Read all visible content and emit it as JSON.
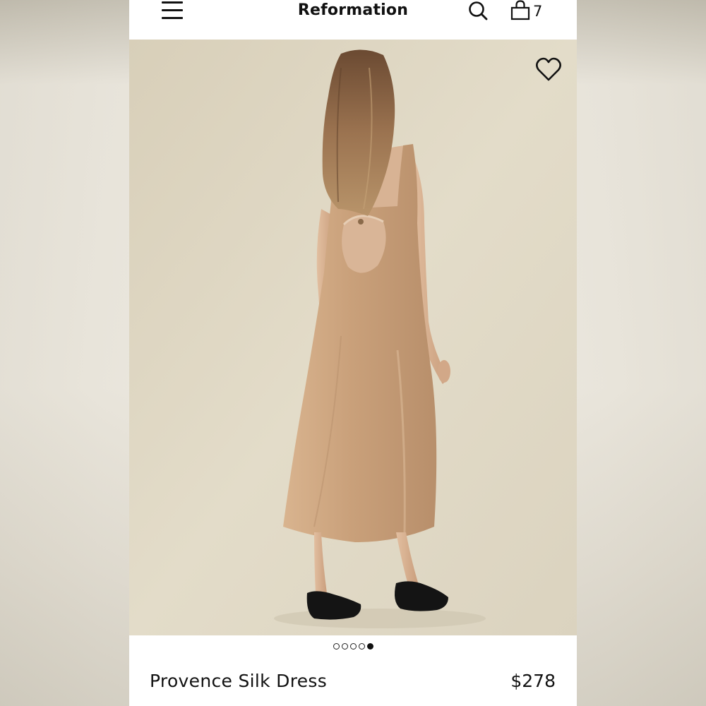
{
  "header": {
    "brand": "Reformation",
    "menu_icon": "hamburger-menu-icon",
    "search_icon": "search-icon",
    "bag_icon": "shopping-bag-icon",
    "bag_count": "7"
  },
  "gallery": {
    "favorite_icon": "heart-outline-icon",
    "image_count": 5,
    "active_index": 5
  },
  "product": {
    "name": "Provence Silk Dress",
    "price": "$278"
  },
  "colors": {
    "text": "#111111",
    "background": "#ffffff",
    "photo_backdrop": "#e2dbc8",
    "dress": "#c9a27e",
    "shoes": "#141414"
  }
}
